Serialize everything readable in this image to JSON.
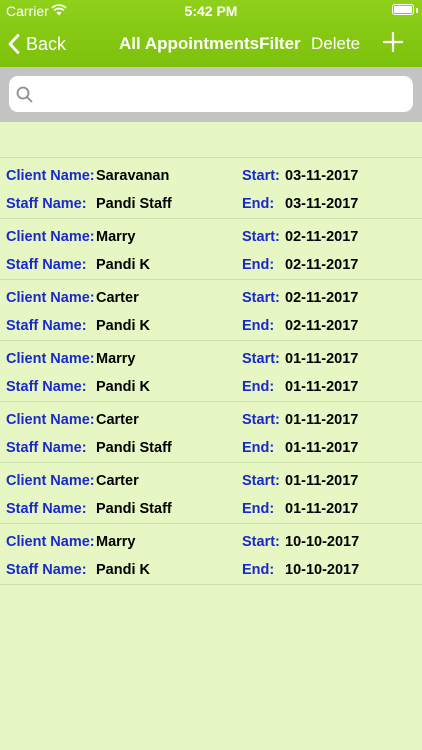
{
  "status_bar": {
    "carrier": "Carrier",
    "time": "5:42 PM"
  },
  "nav": {
    "back_label": "Back",
    "title": "All AppointmentsFilter",
    "delete_label": "Delete"
  },
  "search": {
    "placeholder": ""
  },
  "labels": {
    "client": "Client Name:",
    "staff": "Staff Name:",
    "start": "Start:",
    "end": "End:"
  },
  "appointments": [
    {
      "client": "Saravanan",
      "staff": "Pandi Staff",
      "start": "03-11-2017",
      "end": "03-11-2017"
    },
    {
      "client": "Marry",
      "staff": "Pandi K",
      "start": "02-11-2017",
      "end": "02-11-2017"
    },
    {
      "client": "Carter",
      "staff": "Pandi K",
      "start": "02-11-2017",
      "end": "02-11-2017"
    },
    {
      "client": "Marry",
      "staff": "Pandi K",
      "start": "01-11-2017",
      "end": "01-11-2017"
    },
    {
      "client": "Carter",
      "staff": "Pandi Staff",
      "start": "01-11-2017",
      "end": "01-11-2017"
    },
    {
      "client": "Carter",
      "staff": "Pandi Staff",
      "start": "01-11-2017",
      "end": "01-11-2017"
    },
    {
      "client": "Marry",
      "staff": "Pandi K",
      "start": "10-10-2017",
      "end": "10-10-2017"
    }
  ],
  "colors": {
    "header": "#7cc10c",
    "background": "#e6f7c4",
    "label_blue": "#1a29c9"
  }
}
